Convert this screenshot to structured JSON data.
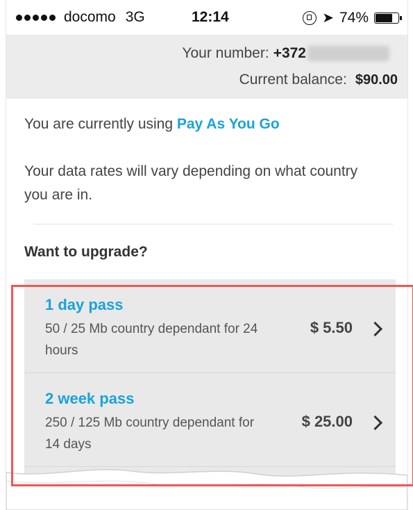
{
  "status_bar": {
    "carrier": "docomo",
    "network": "3G",
    "time": "12:14",
    "battery": "74%",
    "battery_level": 0.74
  },
  "account": {
    "number_label": "Your number:",
    "number_prefix": "+372",
    "balance_label": "Current balance:",
    "balance_value": "$90.00"
  },
  "plan": {
    "current_prefix": "You are currently using",
    "current_plan": "Pay As You Go",
    "rates_note": "Your data rates will vary depending on what country you are in."
  },
  "upgrade": {
    "heading": "Want to upgrade?",
    "passes": [
      {
        "title": "1 day pass",
        "description": "50 / 25 Mb  country dependant  for 24 hours",
        "price": "$ 5.50"
      },
      {
        "title": "2 week pass",
        "description": "250 / 125 Mb  country dependant  for 14 days",
        "price": "$ 25.00"
      }
    ]
  },
  "colors": {
    "accent": "#1aa3d9",
    "highlight_border": "#f25555",
    "header_bg": "#ececec",
    "list_bg": "#e9e9e9"
  }
}
